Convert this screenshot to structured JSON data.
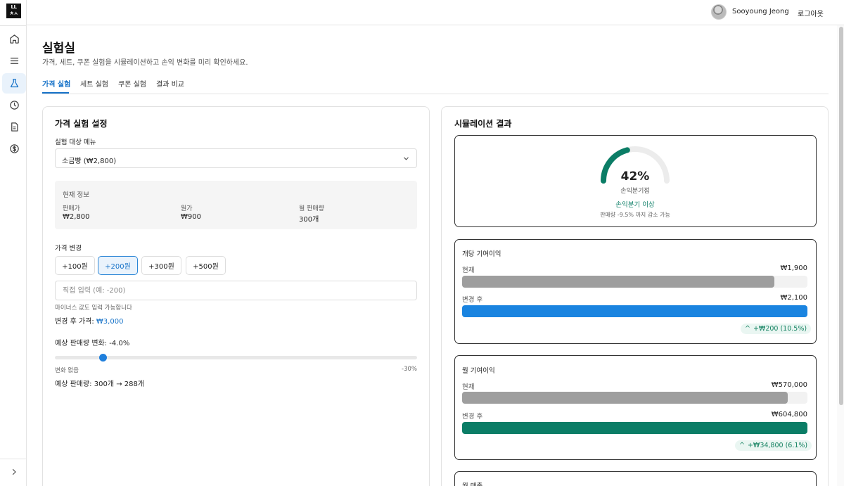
{
  "brand": {
    "logo_text": "LL\nㅊㅅ"
  },
  "sidebar": {
    "items": [
      {
        "icon": "home-icon"
      },
      {
        "icon": "menu-icon"
      },
      {
        "icon": "flask-icon",
        "active": true
      },
      {
        "icon": "clock-icon"
      },
      {
        "icon": "document-icon"
      },
      {
        "icon": "dollar-icon"
      }
    ],
    "expand_icon": "chevron-right-icon"
  },
  "header": {
    "user_name": "Sooyoung Jeong",
    "logout_label": "로그아웃"
  },
  "page": {
    "title": "실험실",
    "description": "가격, 세트, 쿠폰 실험을 시뮬레이션하고 손익 변화를 미리 확인하세요."
  },
  "tabs": [
    {
      "label": "가격 실험",
      "active": true
    },
    {
      "label": "세트 실험"
    },
    {
      "label": "쿠폰 실험"
    },
    {
      "label": "결과 비교"
    }
  ],
  "settings": {
    "title": "가격 실험 설정",
    "menu_label": "실험 대상 메뉴",
    "menu_selected": "소금빵 (₩2,800)",
    "current_info": {
      "title": "현재 정보",
      "items": [
        {
          "label": "판매가",
          "value": "₩2,800"
        },
        {
          "label": "원가",
          "value": "₩900"
        },
        {
          "label": "월 판매량",
          "value": "300개"
        }
      ]
    },
    "price_change": {
      "label": "가격 변경",
      "options": [
        "+100원",
        "+200원",
        "+300원",
        "+500원"
      ],
      "selected_index": 1,
      "input_placeholder": "직접 입력 (예: -200)",
      "hint": "마이너스 값도 입력 가능합니다",
      "after_label": "변경 후 가격:",
      "after_value": "₩3,000"
    },
    "sales_change": {
      "label": "예상 판매량 변화: -4.0%",
      "min_label": "변화 없음",
      "max_label": "-30%",
      "value_pct": -4.0,
      "min_pct": 0,
      "max_pct": -30,
      "forecast": "예상 판매량: 300개 → 288개"
    }
  },
  "results": {
    "title": "시뮬레이션 결과",
    "gauge": {
      "percent_label": "42%",
      "value": 42,
      "caption": "손익분기점",
      "status": "손익분기 이상",
      "note": "판매량 -9.5% 까지 감소 가능"
    },
    "unit_margin": {
      "title": "개당 기여이익",
      "current_label": "현재",
      "current_value": "₩1,900",
      "current_num": 1900,
      "after_label": "변경 후",
      "after_value": "₩2,100",
      "after_num": 2100,
      "change": "+₩200 (10.5%)",
      "color_current": "#9e9e9e",
      "color_after": "#1a84e0"
    },
    "monthly_margin": {
      "title": "월 기여이익",
      "current_label": "현재",
      "current_value": "₩570,000",
      "current_num": 570000,
      "after_label": "변경 후",
      "after_value": "₩604,800",
      "after_num": 604800,
      "change": "+₩34,800 (6.1%)",
      "color_current": "#9e9e9e",
      "color_after": "#0b7d66"
    },
    "monthly_revenue": {
      "title": "월 매출"
    }
  },
  "colors": {
    "accent": "#1672c8",
    "positive": "#0b7d66",
    "gauge": "#0b7d66"
  }
}
